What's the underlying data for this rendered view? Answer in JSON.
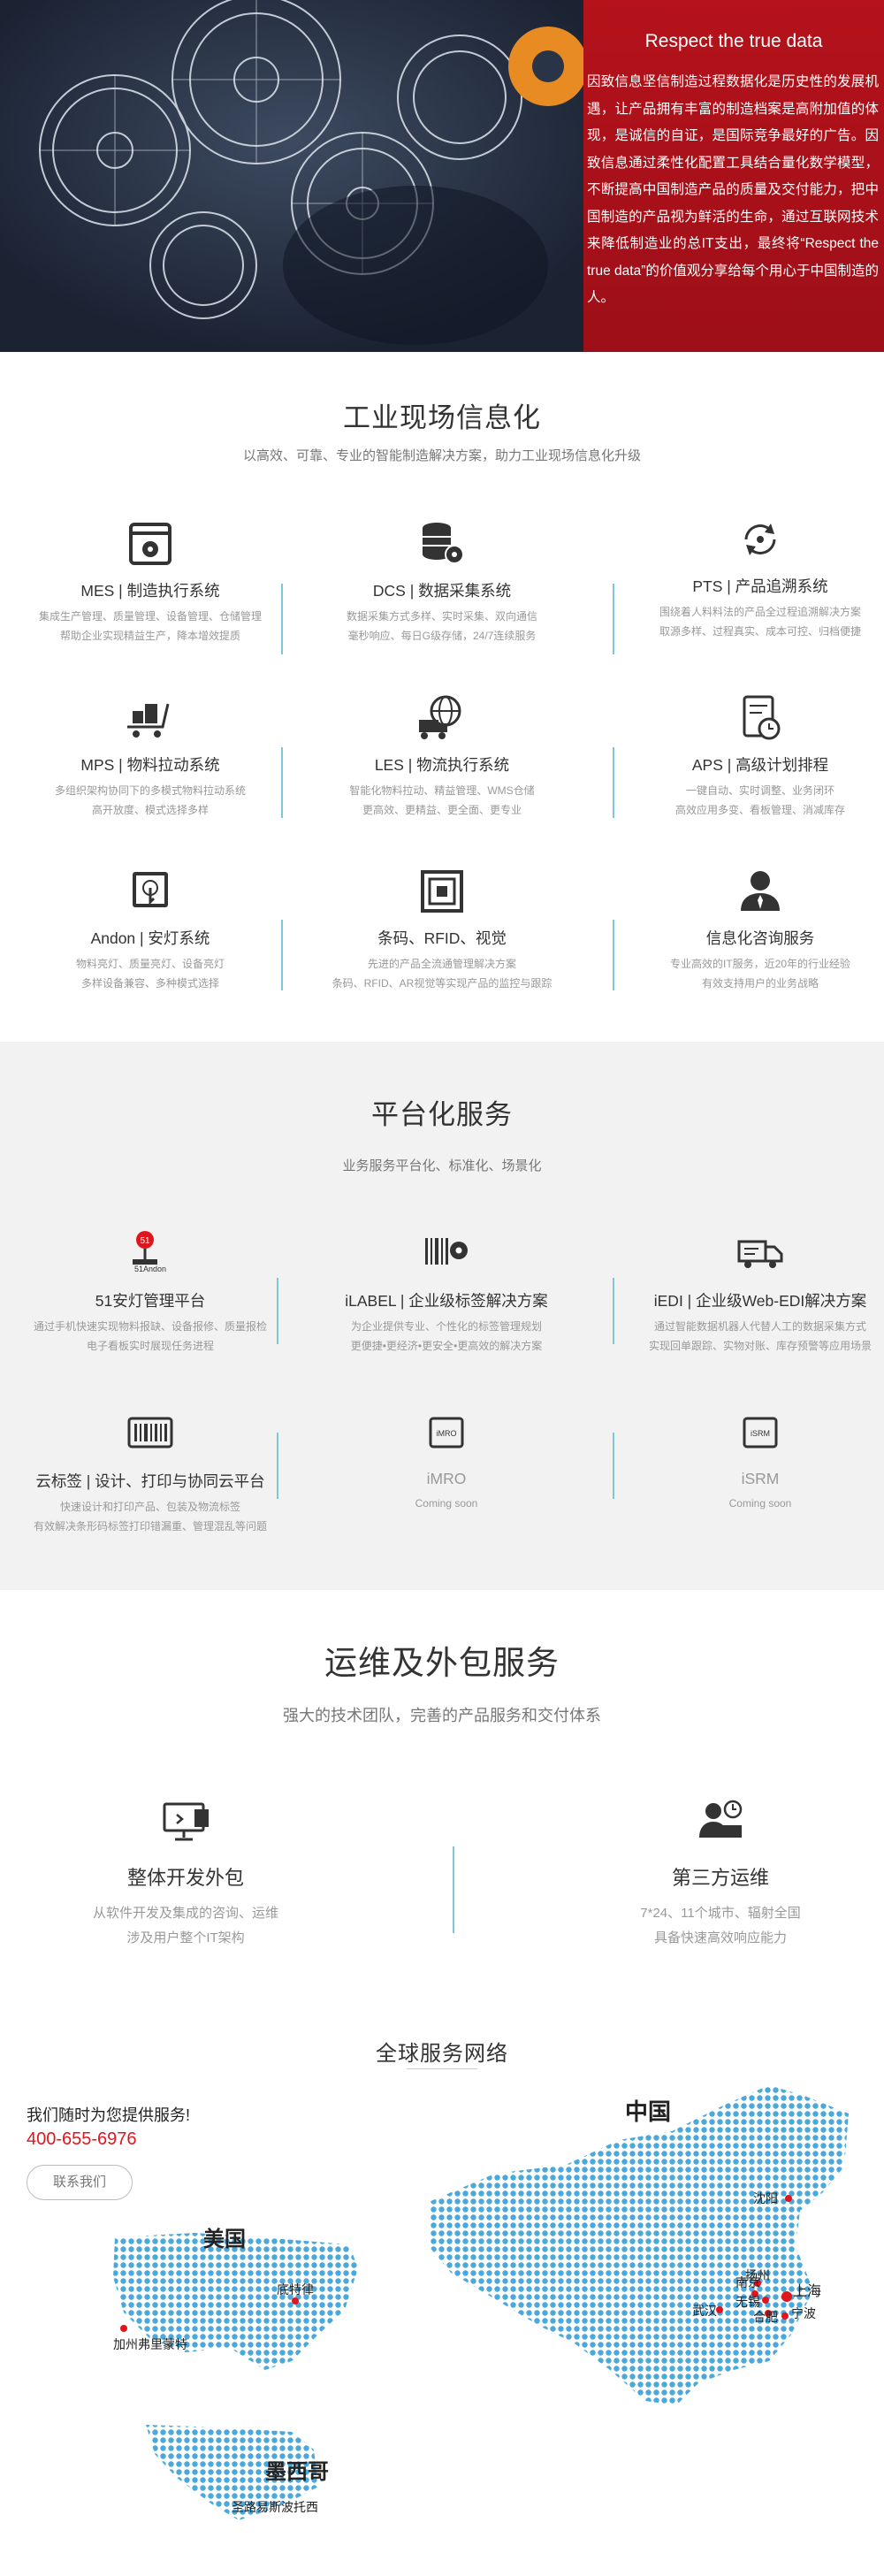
{
  "hero": {
    "title": "Respect the true data",
    "text": "因致信息坚信制造过程数据化是历史性的发展机遇，让产品拥有丰富的制造档案是高附加值的体现，是诚信的自证，是国际竞争最好的广告。因致信息通过柔性化配置工具结合量化数学模型，不断提高中国制造产品的质量及交付能力，把中国制造的产品视为鲜活的生命，通过互联网技术来降低制造业的总IT支出，最终将“Respect the true data”的价值观分享给每个用心于中国制造的人。"
  },
  "industrial": {
    "title": "工业现场信息化",
    "subtitle": "以高效、可靠、专业的智能制造解决方案，助力工业现场信息化升级",
    "items": [
      {
        "title": "MES | 制造执行系统",
        "desc1": "集成生产管理、质量管理、设备管理、仓储管理",
        "desc2": "帮助企业实现精益生产，降本增效提质",
        "icon": "window-gear-icon"
      },
      {
        "title": "DCS | 数据采集系统",
        "desc1": "数据采集方式多样、实时采集、双向通信",
        "desc2": "毫秒响应、每日G级存储，24/7连续服务",
        "icon": "database-gear-icon"
      },
      {
        "title": "PTS | 产品追溯系统",
        "desc1": "围绕着人料料法的产品全过程追溯解决方案",
        "desc2": "取源多样、过程真实、成本可控、归档便捷",
        "icon": "refresh-cycle-icon"
      },
      {
        "title": "MPS | 物料拉动系统",
        "desc1": "多组织架构协同下的多模式物料拉动系统",
        "desc2": "高开放度、模式选择多样",
        "icon": "cart-icon"
      },
      {
        "title": "LES | 物流执行系统",
        "desc1": "智能化物料拉动、精益管理、WMS仓储",
        "desc2": "更高效、更精益、更全面、更专业",
        "icon": "truck-globe-icon"
      },
      {
        "title": "APS | 高级计划排程",
        "desc1": "一键自动、实时调整、业务闭环",
        "desc2": "高效应用多变、看板管理、消减库存",
        "icon": "schedule-clock-icon"
      },
      {
        "title": "Andon | 安灯系统",
        "desc1": "物料亮灯、质量亮灯、设备亮灯",
        "desc2": "多样设备兼容、多种模式选择",
        "icon": "touch-panel-icon"
      },
      {
        "title": "条码、RFID、视觉",
        "desc1": "先进的产品全流通管理解决方案",
        "desc2": "条码、RFID、AR视觉等实现产品的监控与跟踪",
        "icon": "rfid-tag-icon"
      },
      {
        "title": "信息化咨询服务",
        "desc1": "专业高效的IT服务，近20年的行业经验",
        "desc2": "有效支持用户的业务战略",
        "icon": "consultant-icon"
      }
    ]
  },
  "platform": {
    "title": "平台化服务",
    "subtitle": "业务服务平台化、标准化、场景化",
    "items": [
      {
        "title": "51安灯管理平台",
        "desc1": "通过手机快速实现物料报缺、设备报修、质量报检",
        "desc2": "电子看板实时展现任务进程",
        "icon": "andon-logo-icon",
        "badge": "51Andon"
      },
      {
        "title": "iLABEL | 企业级标签解决方案",
        "desc1": "为企业提供专业、个性化的标签管理规划",
        "desc2": "更便捷•更经济•更安全•更高效的解决方案",
        "icon": "barcode-gear-icon"
      },
      {
        "title": "iEDI | 企业级Web-EDI解决方案",
        "desc1": "通过智能数据机器人代替人工的数据采集方式",
        "desc2": "实现回单跟踪、实物对账、库存预警等应用场景",
        "icon": "delivery-truck-icon"
      },
      {
        "title": "云标签 | 设计、打印与协同云平台",
        "desc1": "快速设计和打印产品、包装及物流标签",
        "desc2": "有效解决条形码标签打印错漏重、管理混乱等问题",
        "icon": "barcode-box-icon"
      },
      {
        "title": "iMRO",
        "desc1": "Coming soon",
        "icon": "imro-icon",
        "badge": "iMRO"
      },
      {
        "title": "iSRM",
        "desc1": "Coming soon",
        "icon": "isrm-icon",
        "badge": "iSRM"
      }
    ]
  },
  "ops": {
    "title": "运维及外包服务",
    "subtitle": "强大的技术团队，完善的产品服务和交付体系",
    "items": [
      {
        "title": "整体开发外包",
        "desc1": "从软件开发及集成的咨询、运维",
        "desc2": "涉及用户整个IT架构",
        "icon": "monitor-dev-icon"
      },
      {
        "title": "第三方运维",
        "desc1": "7*24、11个城市、辐射全国",
        "desc2": "具备快速高效响应能力",
        "icon": "support-agent-icon"
      }
    ]
  },
  "network": {
    "title": "全球服务网络",
    "contact_text": "我们随时为您提供服务!",
    "phone": "400-655-6976",
    "contact_button": "联系我们",
    "china_label": "中国",
    "usa_label": "美国",
    "mexico_label": "墨西哥",
    "cities": {
      "shenyang": "沈阳",
      "yangzhou": "扬州",
      "nanjing": "南京",
      "wuxi": "无锡",
      "shanghai": "上海",
      "wuhan": "武汉",
      "hefei": "合肥",
      "ningbo": "宁波",
      "detroit": "底特律",
      "california": "加州弗里蒙特",
      "slp": "圣路易斯波托西"
    }
  },
  "colors": {
    "accent_red": "#b5121b",
    "line_blue": "#7fc6d8",
    "dot_blue": "#4aa8dc",
    "phone_red": "#e0161e"
  }
}
